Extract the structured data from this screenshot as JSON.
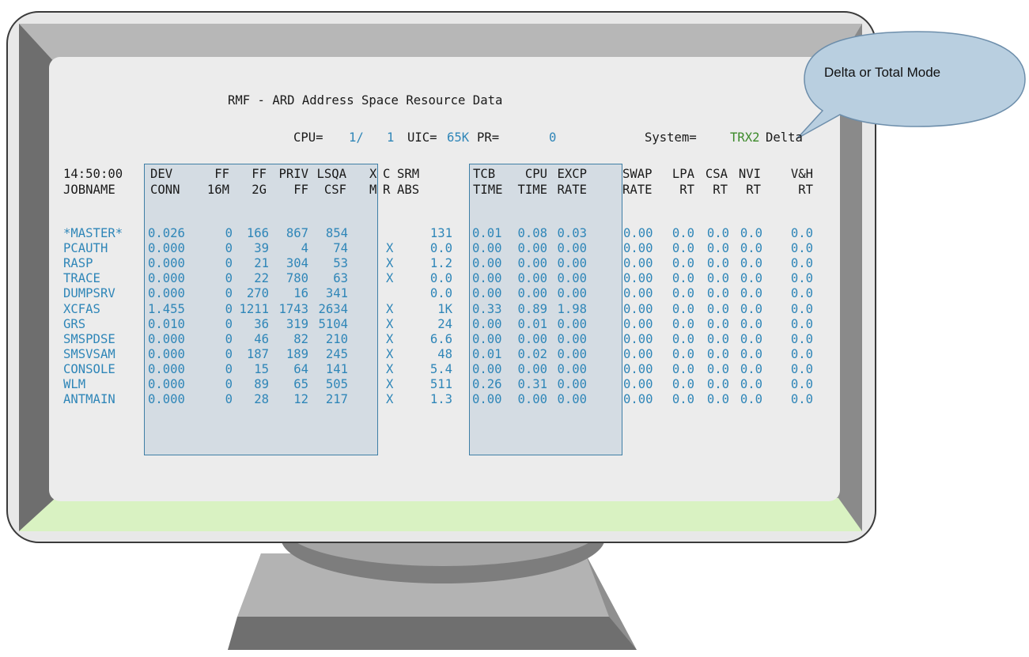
{
  "callout": {
    "text": "Delta or Total Mode"
  },
  "screen": {
    "title": "RMF - ARD Address Space Resource Data",
    "status": {
      "cpu_label": "CPU=",
      "cpu_value": "1/",
      "cpu_value2": "1",
      "uic_label": "UIC=",
      "uic_value": "65K",
      "pr_label": "PR=",
      "pr_value": "0",
      "system_label": "System=",
      "system_value": "TRX2",
      "mode": "Delta"
    },
    "time": "14:50:00",
    "jobname_header": "JOBNAME",
    "headers_line1": [
      "DEV",
      "FF",
      "FF",
      "PRIV",
      "LSQA",
      "X",
      "C",
      "SRM",
      "TCB",
      "CPU",
      "EXCP",
      "SWAP",
      "LPA",
      "CSA",
      "NVI",
      "V&H"
    ],
    "headers_line2": [
      "CONN",
      "16M",
      "2G",
      "FF",
      "CSF",
      "M",
      "R",
      "ABS",
      "TIME",
      "TIME",
      "RATE",
      "RATE",
      "RT",
      "RT",
      "RT",
      "RT"
    ],
    "rows": [
      [
        "*MASTER*",
        "0.026",
        "0",
        "166",
        "867",
        "854",
        "",
        "",
        "131",
        "0.01",
        "0.08",
        "0.03",
        "0.00",
        "0.0",
        "0.0",
        "0.0",
        "0.0"
      ],
      [
        "PCAUTH",
        "0.000",
        "0",
        "39",
        "4",
        "74",
        "X",
        "",
        "0.0",
        "0.00",
        "0.00",
        "0.00",
        "0.00",
        "0.0",
        "0.0",
        "0.0",
        "0.0"
      ],
      [
        "RASP",
        "0.000",
        "0",
        "21",
        "304",
        "53",
        "X",
        "",
        "1.2",
        "0.00",
        "0.00",
        "0.00",
        "0.00",
        "0.0",
        "0.0",
        "0.0",
        "0.0"
      ],
      [
        "TRACE",
        "0.000",
        "0",
        "22",
        "780",
        "63",
        "X",
        "",
        "0.0",
        "0.00",
        "0.00",
        "0.00",
        "0.00",
        "0.0",
        "0.0",
        "0.0",
        "0.0"
      ],
      [
        "DUMPSRV",
        "0.000",
        "0",
        "270",
        "16",
        "341",
        "",
        "",
        "0.0",
        "0.00",
        "0.00",
        "0.00",
        "0.00",
        "0.0",
        "0.0",
        "0.0",
        "0.0"
      ],
      [
        "XCFAS",
        "1.455",
        "0",
        "1211",
        "1743",
        "2634",
        "X",
        "",
        "1K",
        "0.33",
        "0.89",
        "1.98",
        "0.00",
        "0.0",
        "0.0",
        "0.0",
        "0.0"
      ],
      [
        "GRS",
        "0.010",
        "0",
        "36",
        "319",
        "5104",
        "X",
        "",
        "24",
        "0.00",
        "0.01",
        "0.00",
        "0.00",
        "0.0",
        "0.0",
        "0.0",
        "0.0"
      ],
      [
        "SMSPDSE",
        "0.000",
        "0",
        "46",
        "82",
        "210",
        "X",
        "",
        "6.6",
        "0.00",
        "0.00",
        "0.00",
        "0.00",
        "0.0",
        "0.0",
        "0.0",
        "0.0"
      ],
      [
        "SMSVSAM",
        "0.000",
        "0",
        "187",
        "189",
        "245",
        "X",
        "",
        "48",
        "0.01",
        "0.02",
        "0.00",
        "0.00",
        "0.0",
        "0.0",
        "0.0",
        "0.0"
      ],
      [
        "CONSOLE",
        "0.000",
        "0",
        "15",
        "64",
        "141",
        "X",
        "",
        "5.4",
        "0.00",
        "0.00",
        "0.00",
        "0.00",
        "0.0",
        "0.0",
        "0.0",
        "0.0"
      ],
      [
        "WLM",
        "0.000",
        "0",
        "89",
        "65",
        "505",
        "X",
        "",
        "511",
        "0.26",
        "0.31",
        "0.00",
        "0.00",
        "0.0",
        "0.0",
        "0.0",
        "0.0"
      ],
      [
        "ANTMAIN",
        "0.000",
        "0",
        "28",
        "12",
        "217",
        "X",
        "",
        "1.3",
        "0.00",
        "0.00",
        "0.00",
        "0.00",
        "0.0",
        "0.0",
        "0.0",
        "0.0"
      ]
    ]
  },
  "colors": {
    "label": "#1a1a1a",
    "value": "#2f86b8",
    "system": "#3c8a2a",
    "box_border": "#3f7fa6"
  }
}
